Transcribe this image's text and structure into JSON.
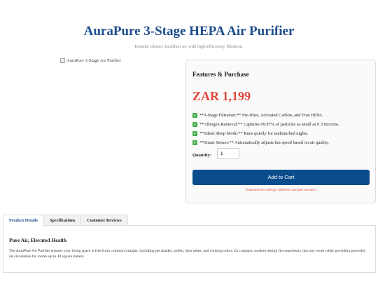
{
  "header": {
    "title": "AuraPure 3-Stage HEPA Air Purifier",
    "subtitle": "Breathe cleaner, healthier air with high-efficiency filtration."
  },
  "product": {
    "image_alt": "AuraPure 3-Stage Air Purifier"
  },
  "purchase": {
    "card_title": "Features & Purchase",
    "price": "ZAR 1,199",
    "features": [
      "**3-Stage Filtration:** Pre-filter, Activated Carbon, and True HEPA.",
      "**Allergen Removal:** Captures 99.97% of particles as small as 0.3 microns.",
      "**Silent Sleep Mode:** Runs quietly for undisturbed nights.",
      "**Smart Sensor:** Automatically adjusts fan speed based on air quality."
    ],
    "quantity_label": "Quantity:",
    "quantity_value": "1",
    "add_to_cart_label": "Add to Cart",
    "promo_text": "Essential for allergy sufferers and pet owners!",
    "feature_icon": "check-mark-icon",
    "accent_color": "#0b4c8c",
    "price_color": "#e0473a"
  },
  "tabs": [
    {
      "label": "Product Details"
    },
    {
      "label": "Specifications"
    },
    {
      "label": "Customer Reviews"
    }
  ],
  "details": {
    "heading": "Pure Air, Elevated Health",
    "body": "The AuraPure Air Purifier ensures your living space is free from common irritants, including pet dander, pollen, dust mites, and cooking odors. Its compact, modern design fits seamlessly into any room while providing powerful air circulation for rooms up to 40 square meters."
  }
}
